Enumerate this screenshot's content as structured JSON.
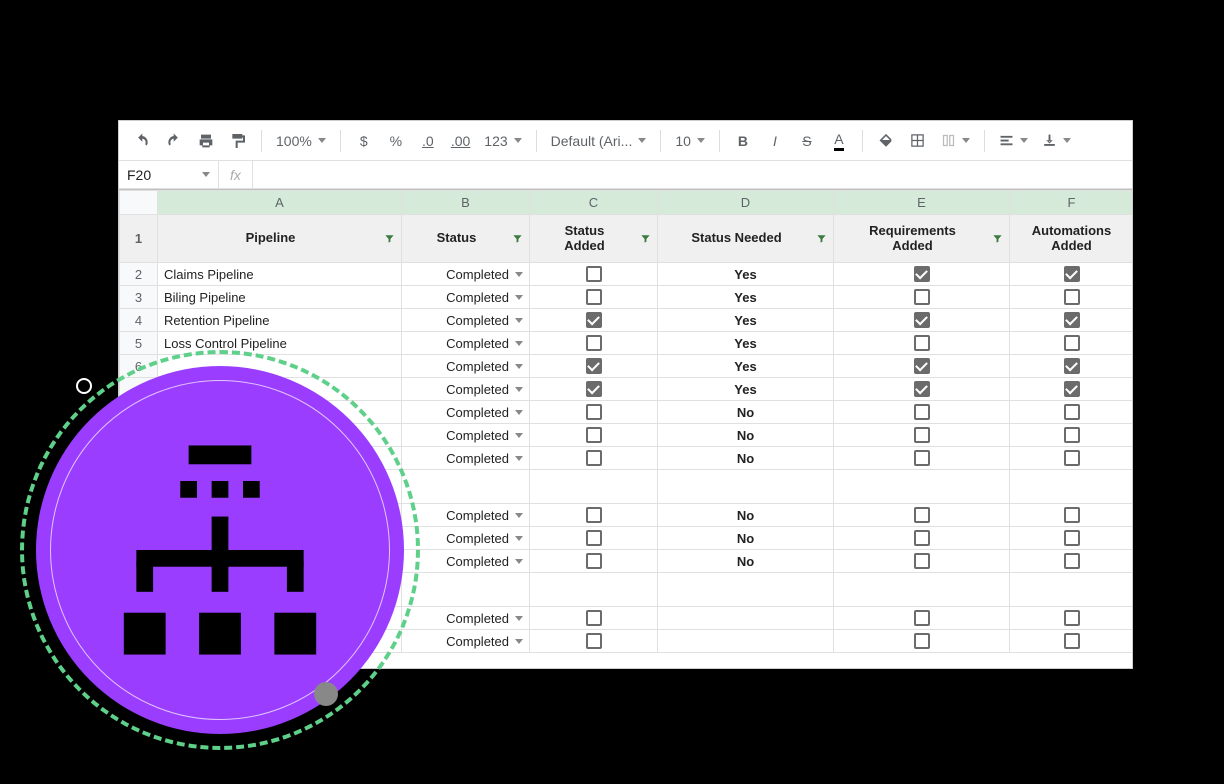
{
  "toolbar": {
    "zoom": "100%",
    "currency": "$",
    "percent": "%",
    "dec_decrease": ".0",
    "dec_increase": ".00",
    "format_more": "123",
    "font": "Default (Ari...",
    "font_size": "10",
    "bold": "B",
    "italic": "I",
    "strike": "S",
    "text_color": "A"
  },
  "name_box": "F20",
  "fx": "fx",
  "columns": [
    "A",
    "B",
    "C",
    "D",
    "E",
    "F"
  ],
  "headers": {
    "pipeline": "Pipeline",
    "status": "Status",
    "status_added": "Status\nAdded",
    "status_needed": "Status Needed",
    "requirements_added": "Requirements\nAdded",
    "automations_added": "Automations\nAdded"
  },
  "rows": [
    {
      "n": "2",
      "pipeline": "Claims Pipeline",
      "status": "Completed",
      "status_added": false,
      "status_needed": "Yes",
      "req": true,
      "auto": true
    },
    {
      "n": "3",
      "pipeline": "Biling Pipeline",
      "status": "Completed",
      "status_added": false,
      "status_needed": "Yes",
      "req": false,
      "auto": false
    },
    {
      "n": "4",
      "pipeline": "Retention Pipeline",
      "status": "Completed",
      "status_added": true,
      "status_needed": "Yes",
      "req": true,
      "auto": true
    },
    {
      "n": "5",
      "pipeline": "Loss Control Pipeline",
      "status": "Completed",
      "status_added": false,
      "status_needed": "Yes",
      "req": false,
      "auto": false
    },
    {
      "n": "6",
      "pipeline": "",
      "status": "Completed",
      "status_added": true,
      "status_needed": "Yes",
      "req": true,
      "auto": true
    },
    {
      "n": "",
      "pipeline": "",
      "status": "Completed",
      "status_added": true,
      "status_needed": "Yes",
      "req": true,
      "auto": true
    },
    {
      "n": "",
      "pipeline": "",
      "status": "Completed",
      "status_added": false,
      "status_needed": "No",
      "req": false,
      "auto": false
    },
    {
      "n": "",
      "pipeline": "",
      "status": "Completed",
      "status_added": false,
      "status_needed": "No",
      "req": false,
      "auto": false
    },
    {
      "n": "",
      "pipeline": "",
      "status": "Completed",
      "status_added": false,
      "status_needed": "No",
      "req": false,
      "auto": false
    },
    {
      "n": "",
      "pipeline": "",
      "status": "",
      "status_added": null,
      "status_needed": "",
      "req": null,
      "auto": null
    },
    {
      "n": "",
      "pipeline": "",
      "status": "Completed",
      "status_added": false,
      "status_needed": "No",
      "req": false,
      "auto": false
    },
    {
      "n": "",
      "pipeline": "",
      "status": "Completed",
      "status_added": false,
      "status_needed": "No",
      "req": false,
      "auto": false
    },
    {
      "n": "",
      "pipeline": "",
      "status": "Completed",
      "status_added": false,
      "status_needed": "No",
      "req": false,
      "auto": false
    },
    {
      "n": "",
      "pipeline": "",
      "status": "",
      "status_added": null,
      "status_needed": "",
      "req": null,
      "auto": null
    },
    {
      "n": "",
      "pipeline": "",
      "status": "Completed",
      "status_added": false,
      "status_needed": "",
      "req": false,
      "auto": false
    },
    {
      "n": "",
      "pipeline": "",
      "status": "Completed",
      "status_added": false,
      "status_needed": "",
      "req": false,
      "auto": false
    }
  ],
  "badge": {
    "icon_name": "org-chart-icon"
  }
}
